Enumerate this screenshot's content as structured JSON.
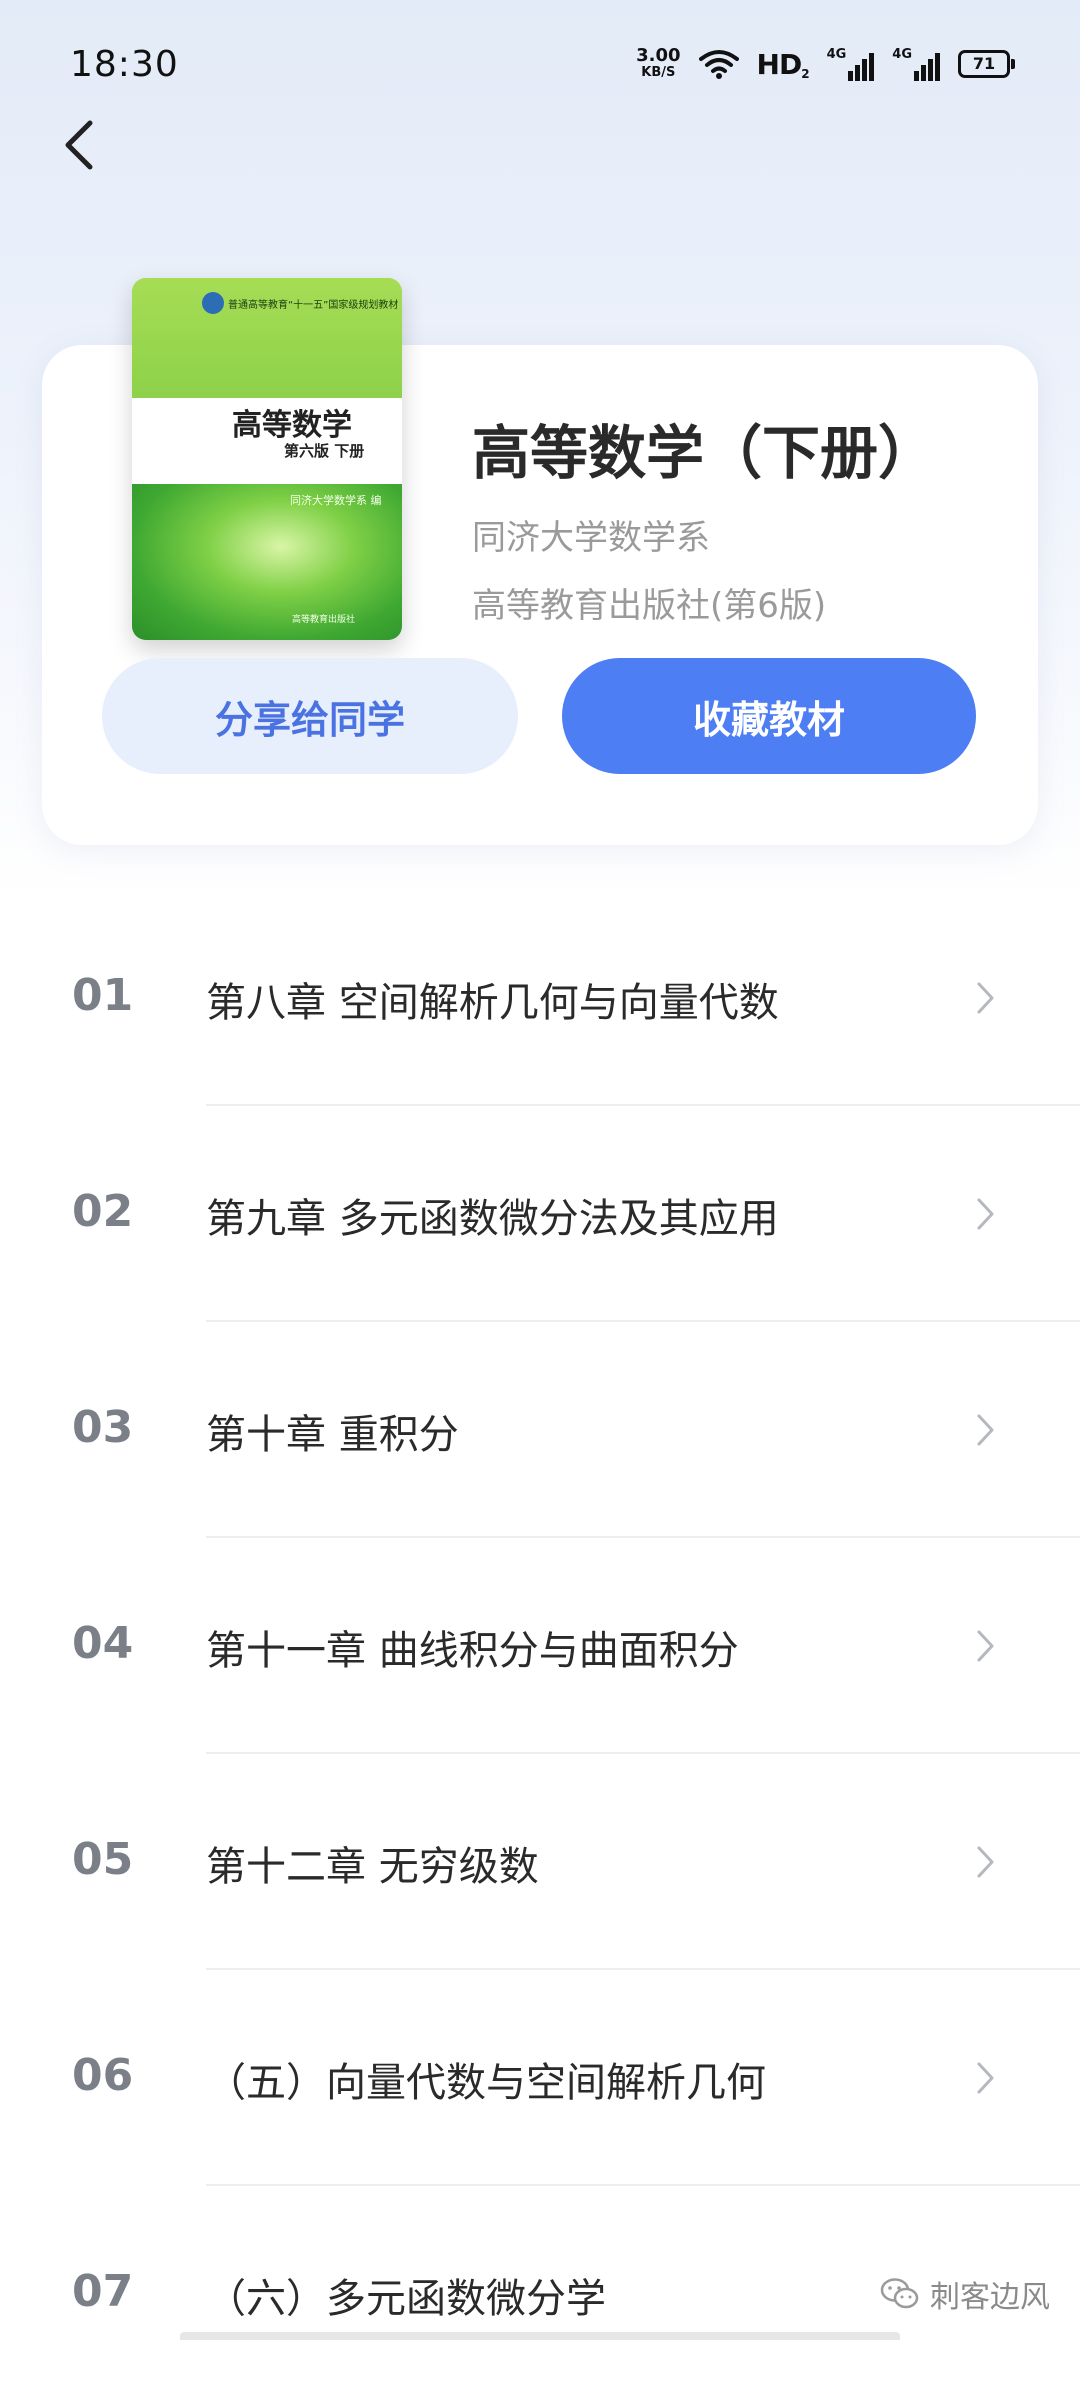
{
  "status_bar": {
    "time": "18:30",
    "net_speed_value": "3.00",
    "net_speed_unit": "KB/S",
    "hd_label": "HD",
    "hd_sub": "2",
    "network_label_1": "4G",
    "network_label_2": "4G",
    "battery_level": "71"
  },
  "nav": {
    "back_icon": "chevron-left-icon"
  },
  "book": {
    "cover": {
      "series_text": "普通高等教育“十一五”国家级规划教材",
      "title": "高等数学",
      "edition": "第六版 下册",
      "author": "同济大学数学系 编",
      "publisher": "高等教育出版社"
    },
    "title": "高等数学（下册）",
    "author": "同济大学数学系",
    "publisher": "高等教育出版社(第6版)"
  },
  "actions": {
    "share_label": "分享给同学",
    "collect_label": "收藏教材"
  },
  "chapters": [
    {
      "num": "01",
      "title": "第八章 空间解析几何与向量代数"
    },
    {
      "num": "02",
      "title": "第九章 多元函数微分法及其应用"
    },
    {
      "num": "03",
      "title": "第十章 重积分"
    },
    {
      "num": "04",
      "title": "第十一章 曲线积分与曲面积分"
    },
    {
      "num": "05",
      "title": "第十二章 无穷级数"
    },
    {
      "num": "06",
      "title": "（五）向量代数与空间解析几何"
    },
    {
      "num": "07",
      "title": "（六）多元函数微分学"
    }
  ],
  "watermark": {
    "text": "刺客边风",
    "icon": "wechat-icon"
  },
  "colors": {
    "accent": "#4d7ef4",
    "share_bg": "#e7effd",
    "share_text": "#4a72e0"
  }
}
